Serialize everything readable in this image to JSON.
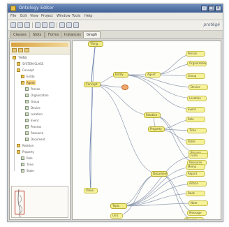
{
  "window": {
    "title": "Ontology Editor",
    "buttons": [
      {
        "name": "minimize",
        "glyph": "–"
      },
      {
        "name": "maximize",
        "glyph": "□"
      },
      {
        "name": "close",
        "glyph": "×"
      }
    ]
  },
  "menu": {
    "items": [
      "File",
      "Edit",
      "View",
      "Project",
      "Window",
      "Tools",
      "Help"
    ]
  },
  "toolbar": {
    "logo": "protégé"
  },
  "tabs": [
    {
      "label": "Classes",
      "active": false
    },
    {
      "label": "Slots",
      "active": false
    },
    {
      "label": "Forms",
      "active": false
    },
    {
      "label": "Instances",
      "active": false
    },
    {
      "label": "Graph",
      "active": true
    }
  ],
  "tree": {
    "rows": [
      {
        "label": "THING",
        "depth": 0,
        "leaf": false,
        "selected": false
      },
      {
        "label": "SYSTEM-CLASS",
        "depth": 1,
        "leaf": false,
        "selected": false
      },
      {
        "label": "Concept",
        "depth": 1,
        "leaf": false,
        "selected": false
      },
      {
        "label": "Entity",
        "depth": 2,
        "leaf": false,
        "selected": false
      },
      {
        "label": "Agent",
        "depth": 2,
        "leaf": false,
        "selected": true
      },
      {
        "label": "Person",
        "depth": 3,
        "leaf": true,
        "selected": false
      },
      {
        "label": "Organization",
        "depth": 3,
        "leaf": true,
        "selected": false
      },
      {
        "label": "Group",
        "depth": 3,
        "leaf": true,
        "selected": false
      },
      {
        "label": "Device",
        "depth": 3,
        "leaf": true,
        "selected": false
      },
      {
        "label": "Location",
        "depth": 3,
        "leaf": true,
        "selected": false
      },
      {
        "label": "Event",
        "depth": 3,
        "leaf": true,
        "selected": false
      },
      {
        "label": "Process",
        "depth": 3,
        "leaf": true,
        "selected": false
      },
      {
        "label": "Resource",
        "depth": 3,
        "leaf": true,
        "selected": false
      },
      {
        "label": "Document",
        "depth": 3,
        "leaf": true,
        "selected": false
      },
      {
        "label": "Relation",
        "depth": 1,
        "leaf": false,
        "selected": false
      },
      {
        "label": "Property",
        "depth": 1,
        "leaf": false,
        "selected": false
      },
      {
        "label": "Role",
        "depth": 2,
        "leaf": true,
        "selected": false
      },
      {
        "label": "Time",
        "depth": 2,
        "leaf": true,
        "selected": false
      },
      {
        "label": "State",
        "depth": 2,
        "leaf": true,
        "selected": false
      }
    ]
  },
  "graph": {
    "nodes": [
      {
        "id": "root",
        "label": "Thing",
        "kind": "hub"
      },
      {
        "id": "concept",
        "label": "Concept",
        "kind": "hub"
      },
      {
        "id": "entity",
        "label": "Entity",
        "kind": "hub"
      },
      {
        "id": "selected",
        "label": "",
        "kind": "alert"
      },
      {
        "id": "agent",
        "label": "Agent",
        "kind": "normal"
      },
      {
        "id": "r1",
        "label": "Person",
        "kind": "normal"
      },
      {
        "id": "r2",
        "label": "Organization",
        "kind": "normal"
      },
      {
        "id": "r3",
        "label": "Group",
        "kind": "normal"
      },
      {
        "id": "r4",
        "label": "Device",
        "kind": "normal"
      },
      {
        "id": "r5",
        "label": "Location",
        "kind": "normal"
      },
      {
        "id": "r6",
        "label": "Event",
        "kind": "normal"
      },
      {
        "id": "mid1",
        "label": "Relation",
        "kind": "hub"
      },
      {
        "id": "mid2",
        "label": "Property",
        "kind": "hub"
      },
      {
        "id": "m1",
        "label": "Role",
        "kind": "normal"
      },
      {
        "id": "m2",
        "label": "Time",
        "kind": "normal"
      },
      {
        "id": "m3",
        "label": "State",
        "kind": "normal"
      },
      {
        "id": "m4",
        "label": "Process",
        "kind": "normal"
      },
      {
        "id": "m5",
        "label": "Resource",
        "kind": "normal"
      },
      {
        "id": "low1",
        "label": "Document",
        "kind": "hub"
      },
      {
        "id": "low2",
        "label": "Topic",
        "kind": "hub"
      },
      {
        "id": "b1",
        "label": "Report",
        "kind": "normal"
      },
      {
        "id": "b2",
        "label": "Article",
        "kind": "normal"
      },
      {
        "id": "b3",
        "label": "Book",
        "kind": "normal"
      },
      {
        "id": "b4",
        "label": "Note",
        "kind": "normal"
      },
      {
        "id": "b5",
        "label": "Message",
        "kind": "normal"
      },
      {
        "id": "b6",
        "label": "Record",
        "kind": "normal"
      },
      {
        "id": "b7",
        "label": "Form",
        "kind": "normal"
      },
      {
        "id": "b8",
        "label": "Memo",
        "kind": "normal"
      },
      {
        "id": "bottom",
        "label": "Value",
        "kind": "normal"
      },
      {
        "id": "bottom2",
        "label": "Unit",
        "kind": "normal"
      }
    ],
    "edges": [
      [
        "root",
        "concept"
      ],
      [
        "concept",
        "entity"
      ],
      [
        "concept",
        "selected"
      ],
      [
        "entity",
        "agent"
      ],
      [
        "agent",
        "r1"
      ],
      [
        "agent",
        "r2"
      ],
      [
        "agent",
        "r3"
      ],
      [
        "entity",
        "r4"
      ],
      [
        "entity",
        "r5"
      ],
      [
        "entity",
        "r6"
      ],
      [
        "concept",
        "mid1"
      ],
      [
        "mid1",
        "mid2"
      ],
      [
        "mid2",
        "m1"
      ],
      [
        "mid2",
        "m2"
      ],
      [
        "mid2",
        "m3"
      ],
      [
        "mid1",
        "m4"
      ],
      [
        "mid1",
        "m5"
      ],
      [
        "concept",
        "low1"
      ],
      [
        "low1",
        "low2"
      ],
      [
        "low2",
        "b1"
      ],
      [
        "low2",
        "b2"
      ],
      [
        "low2",
        "b3"
      ],
      [
        "low2",
        "b4"
      ],
      [
        "low1",
        "b5"
      ],
      [
        "low1",
        "b6"
      ],
      [
        "low2",
        "b7"
      ],
      [
        "low2",
        "b8"
      ],
      [
        "concept",
        "bottom"
      ],
      [
        "low1",
        "bottom2"
      ]
    ]
  }
}
